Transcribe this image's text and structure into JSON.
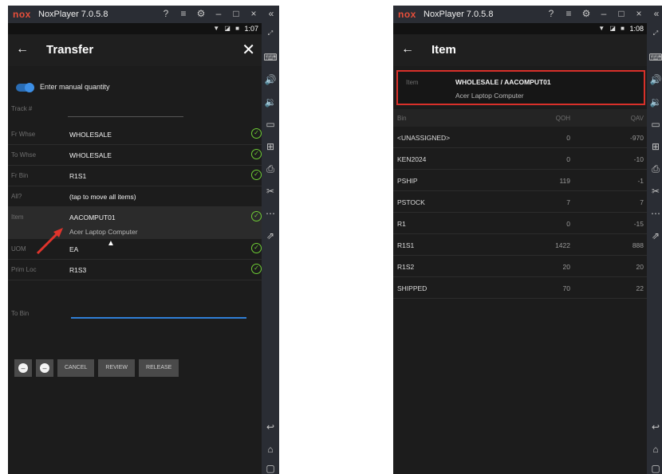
{
  "emulator": {
    "logo": "nox",
    "app_name": "NoxPlayer 7.0.5.8",
    "titlebar_icons": [
      "help-icon",
      "menu-icon",
      "settings-icon",
      "minimize-icon",
      "maximize-icon",
      "close-icon",
      "collapse-icon"
    ],
    "sidebar_icons": [
      "resize-icon",
      "keyboard-icon",
      "volume-up-icon",
      "volume-down-icon",
      "screen-icon",
      "install-apk-icon",
      "print-icon",
      "cut-icon",
      "more-icon",
      "share-icon",
      "back-icon",
      "home-icon",
      "recent-apps-icon"
    ]
  },
  "left": {
    "status_time": "1:07",
    "appbar": {
      "title": "Transfer"
    },
    "manual_qty_label": "Enter manual quantity",
    "track_label": "Track #",
    "fields": [
      {
        "label": "Fr Whse",
        "value": "WHOLESALE",
        "check": true
      },
      {
        "label": "To Whse",
        "value": "WHOLESALE",
        "check": true
      },
      {
        "label": "Fr Bin",
        "value": "R1S1",
        "check": true
      },
      {
        "label": "All?",
        "value": "(tap to move all items)",
        "check": false
      },
      {
        "label": "Item",
        "value": "AACOMPUT01",
        "sub": "Acer Laptop Computer",
        "check": true
      },
      {
        "label": "UOM",
        "value": "EA",
        "check": true
      },
      {
        "label": "Prim Loc",
        "value": "R1S3",
        "check": true
      }
    ],
    "tobin_label": "To Bin",
    "buttons": {
      "cancel": "CANCEL",
      "review": "REVIEW",
      "release": "RELEASE"
    }
  },
  "right": {
    "status_time": "1:08",
    "appbar": {
      "title": "Item"
    },
    "item_label": "Item",
    "item_value": "WHOLESALE / AACOMPUT01",
    "item_desc": "Acer Laptop Computer",
    "columns": [
      "Bin",
      "QOH",
      "QAV"
    ],
    "rows": [
      {
        "bin": "<UNASSIGNED>",
        "qoh": "0",
        "qav": "-970"
      },
      {
        "bin": "KEN2024",
        "qoh": "0",
        "qav": "-10"
      },
      {
        "bin": "PSHIP",
        "qoh": "119",
        "qav": "-1"
      },
      {
        "bin": "PSTOCK",
        "qoh": "7",
        "qav": "7"
      },
      {
        "bin": "R1",
        "qoh": "0",
        "qav": "-15"
      },
      {
        "bin": "R1S1",
        "qoh": "1422",
        "qav": "888"
      },
      {
        "bin": "R1S2",
        "qoh": "20",
        "qav": "20"
      },
      {
        "bin": "SHIPPED",
        "qoh": "70",
        "qav": "22"
      }
    ]
  },
  "colors": {
    "accent_blue": "#2f7fd6",
    "check_green": "#6fcf35",
    "highlight_red": "#d9302a",
    "nox_red": "#e94f3a"
  }
}
